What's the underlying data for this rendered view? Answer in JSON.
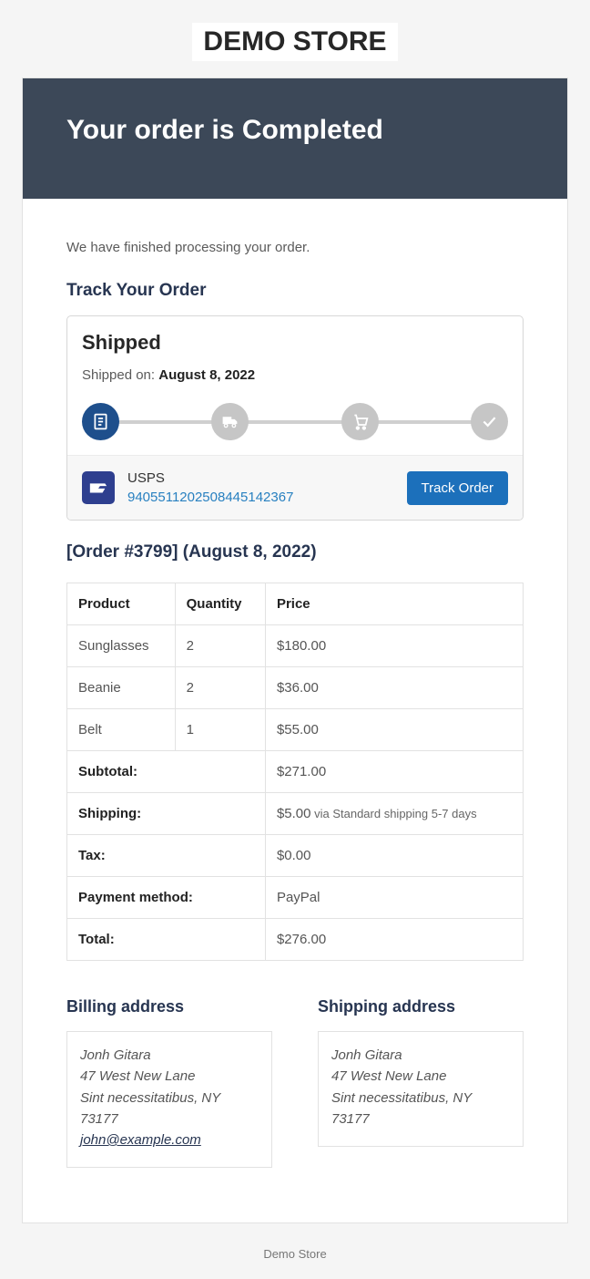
{
  "store": {
    "name": "DEMO STORE",
    "footer": "Demo Store"
  },
  "header": {
    "title": "Your order is Completed"
  },
  "intro": "We have finished processing your order.",
  "track": {
    "section_title": "Track Your Order",
    "status_title": "Shipped",
    "shipped_on_label": "Shipped on: ",
    "shipped_on_date": "August 8, 2022",
    "carrier_name": "USPS",
    "tracking_number": "9405511202508445142367",
    "button": "Track Order"
  },
  "order": {
    "heading": "[Order #3799] (August 8, 2022)",
    "columns": {
      "product": "Product",
      "qty": "Quantity",
      "price": "Price"
    },
    "items": [
      {
        "product": "Sunglasses",
        "qty": "2",
        "price": "$180.00"
      },
      {
        "product": "Beanie",
        "qty": "2",
        "price": "$36.00"
      },
      {
        "product": "Belt",
        "qty": "1",
        "price": "$55.00"
      }
    ],
    "summary": {
      "subtotal_label": "Subtotal:",
      "subtotal": "$271.00",
      "shipping_label": "Shipping:",
      "shipping": "$5.00",
      "shipping_via": " via Standard shipping 5-7 days",
      "tax_label": "Tax:",
      "tax": "$0.00",
      "payment_label": "Payment method:",
      "payment": "PayPal",
      "total_label": "Total:",
      "total": "$276.00"
    }
  },
  "billing": {
    "title": "Billing address",
    "name": "Jonh Gitara",
    "line1": "47 West New Lane",
    "line2": "Sint necessitatibus, NY 73177",
    "email": "john@example.com"
  },
  "shipping": {
    "title": "Shipping address",
    "name": "Jonh Gitara",
    "line1": "47 West New Lane",
    "line2": "Sint necessitatibus, NY 73177"
  }
}
